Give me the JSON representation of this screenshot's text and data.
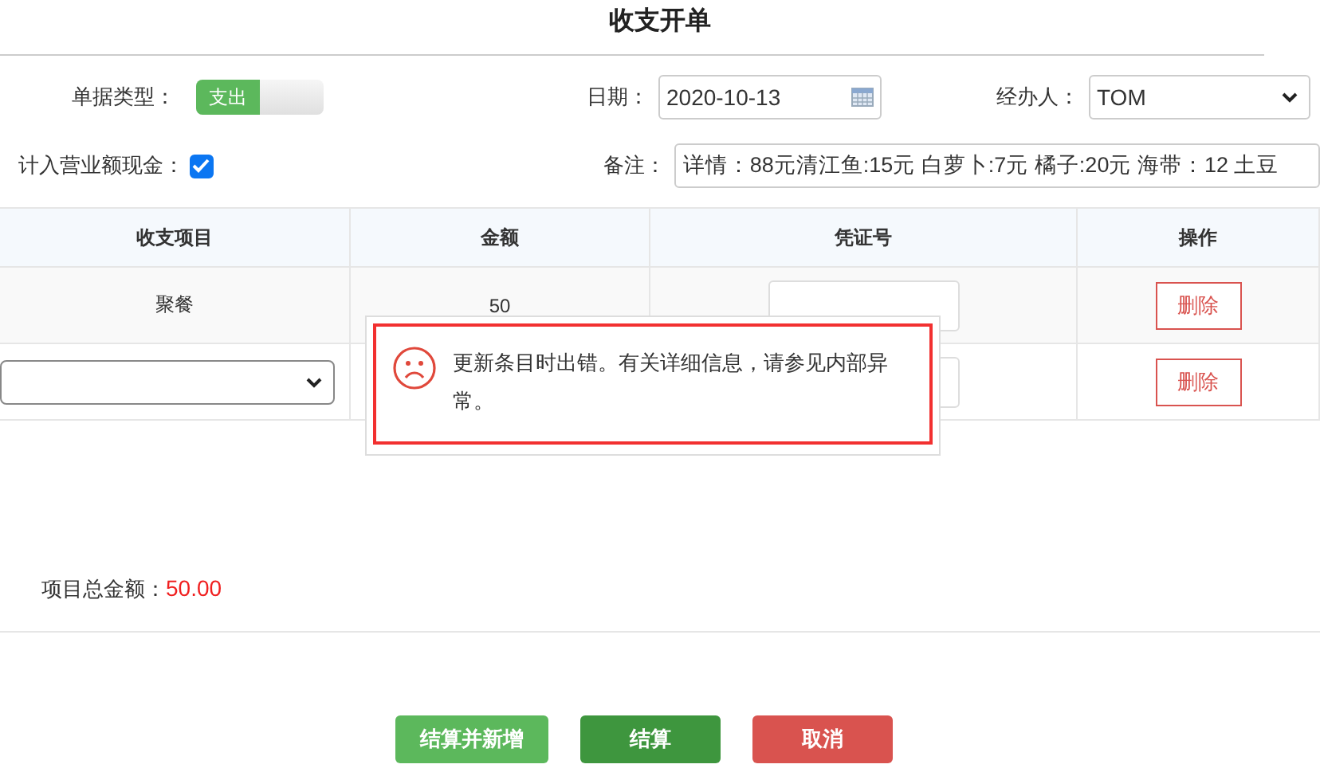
{
  "title": "收支开单",
  "form": {
    "type_label": "单据类型：",
    "type_toggle": {
      "label": "支出",
      "on": true
    },
    "date_label": "日期：",
    "date_value": "2020-10-13",
    "handler_label": "经办人：",
    "handler_value": "TOM",
    "cash_label": "计入营业额现金：",
    "cash_checked": true,
    "note_label": "备注：",
    "note_value": "详情：88元清江鱼:15元  白萝卜:7元  橘子:20元  海带：12   土豆"
  },
  "table": {
    "columns": [
      "收支项目",
      "金额",
      "凭证号",
      "操作"
    ],
    "rows": [
      {
        "kind": "text",
        "item": "聚餐",
        "amount": "50",
        "action": "删除"
      },
      {
        "kind": "select",
        "action": "删除"
      }
    ]
  },
  "error": {
    "message": "更新条目时出错。有关详细信息，请参见内部异常。"
  },
  "total": {
    "label": "项目总金额：",
    "value": "50.00"
  },
  "buttons": [
    {
      "label": "结算并新增",
      "kind": "light"
    },
    {
      "label": "结算",
      "kind": "dark"
    },
    {
      "label": "取消",
      "kind": "danger"
    }
  ]
}
